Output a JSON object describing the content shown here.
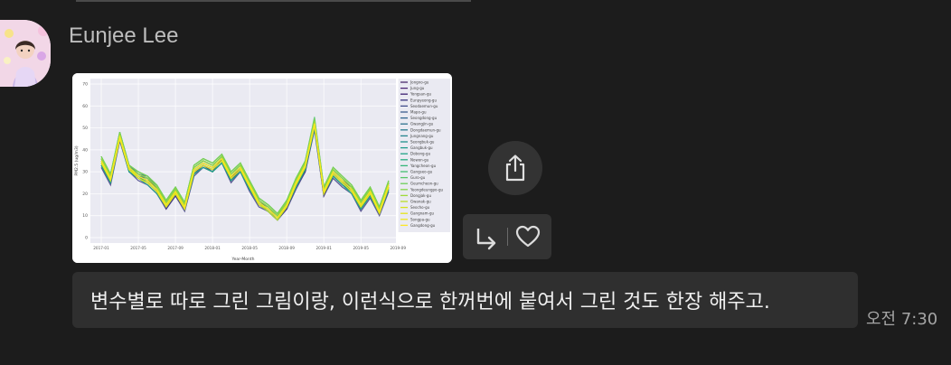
{
  "message": {
    "sender_name": "Eunjee Lee",
    "text": "변수별로 따로 그린 그림이랑, 이런식으로 한꺼번에 붙여서 그린 것도 한장 해주고.",
    "timestamp": "오전 7:30"
  },
  "icons": {
    "share": "share-icon",
    "reply": "reply-icon",
    "like": "heart-icon",
    "avatar": "avatar"
  },
  "colors": {
    "background": "#1c1c1c",
    "bubble": "#2f2f2f",
    "button": "#333333"
  },
  "chart_data": {
    "type": "line",
    "xlabel": "Year-Month",
    "ylabel": "PM2.5 (ug/m3)",
    "ylim": [
      0,
      70
    ],
    "y_ticks": [
      "0",
      "10",
      "20",
      "30",
      "40",
      "50",
      "60",
      "70"
    ],
    "x_ticks": [
      "2017-01",
      "2017-05",
      "2017-09",
      "2018-01",
      "2018-05",
      "2018-09",
      "2019-01",
      "2019-05",
      "2019-09"
    ],
    "grid": true,
    "legend_position": "right",
    "series": [
      {
        "name": "Jongno-gu",
        "color": "#46246a",
        "values": [
          34,
          26,
          46,
          31,
          28,
          26,
          22,
          14,
          20,
          14,
          30,
          33,
          30,
          36,
          27,
          32,
          23,
          16,
          13,
          9,
          14,
          24,
          31,
          51,
          20,
          29,
          25,
          22,
          14,
          20,
          12,
          23
        ]
      },
      {
        "name": "Jung-gu",
        "color": "#482173",
        "values": [
          33,
          25,
          45,
          30,
          27,
          25,
          21,
          13,
          19,
          13,
          29,
          33,
          31,
          35,
          26,
          31,
          22,
          15,
          12,
          8,
          13,
          23,
          30,
          50,
          19,
          28,
          24,
          21,
          13,
          19,
          11,
          22
        ]
      },
      {
        "name": "Yongsan-gu",
        "color": "#472c7a",
        "values": [
          35,
          27,
          47,
          32,
          29,
          27,
          22,
          15,
          21,
          14,
          31,
          34,
          32,
          36,
          28,
          32,
          24,
          16,
          13,
          9,
          15,
          25,
          33,
          52,
          21,
          30,
          26,
          23,
          15,
          21,
          13,
          24
        ]
      },
      {
        "name": "Eunpyeong-gu",
        "color": "#433e85",
        "values": [
          32,
          24,
          44,
          30,
          26,
          24,
          20,
          13,
          19,
          12,
          28,
          32,
          30,
          34,
          25,
          30,
          21,
          14,
          12,
          8,
          13,
          22,
          30,
          49,
          19,
          27,
          23,
          20,
          12,
          18,
          10,
          21
        ]
      },
      {
        "name": "Seodaemun-gu",
        "color": "#3e4c8a",
        "values": [
          34,
          26,
          46,
          31,
          28,
          26,
          22,
          14,
          20,
          14,
          30,
          33,
          31,
          35,
          27,
          31,
          23,
          16,
          13,
          9,
          14,
          24,
          32,
          51,
          20,
          29,
          25,
          22,
          14,
          20,
          12,
          23
        ]
      },
      {
        "name": "Mapo-gu",
        "color": "#38598c",
        "values": [
          35,
          27,
          47,
          32,
          28,
          27,
          22,
          15,
          21,
          14,
          31,
          34,
          32,
          36,
          28,
          32,
          24,
          16,
          14,
          10,
          15,
          25,
          33,
          52,
          21,
          30,
          26,
          22,
          15,
          21,
          12,
          24
        ]
      },
      {
        "name": "Seongdong-gu",
        "color": "#32658e",
        "values": [
          36,
          28,
          48,
          33,
          29,
          28,
          23,
          16,
          22,
          15,
          32,
          35,
          33,
          37,
          29,
          33,
          25,
          17,
          14,
          10,
          16,
          26,
          34,
          53,
          22,
          31,
          27,
          23,
          16,
          22,
          13,
          25
        ]
      },
      {
        "name": "Gwangjin-gu",
        "color": "#2d718e",
        "values": [
          35,
          27,
          46,
          31,
          28,
          26,
          22,
          15,
          21,
          14,
          31,
          34,
          32,
          36,
          28,
          32,
          24,
          16,
          13,
          9,
          15,
          25,
          33,
          52,
          21,
          30,
          26,
          22,
          15,
          21,
          12,
          24
        ]
      },
      {
        "name": "Dongdaemun-gu",
        "color": "#297b8e",
        "values": [
          36,
          28,
          47,
          32,
          29,
          27,
          23,
          16,
          22,
          15,
          32,
          35,
          33,
          37,
          29,
          33,
          25,
          17,
          14,
          10,
          16,
          26,
          34,
          53,
          22,
          31,
          27,
          23,
          16,
          22,
          13,
          25
        ]
      },
      {
        "name": "Jungnang-gu",
        "color": "#25858e",
        "values": [
          34,
          26,
          46,
          31,
          28,
          25,
          21,
          14,
          20,
          13,
          30,
          33,
          31,
          35,
          27,
          31,
          23,
          15,
          13,
          9,
          14,
          24,
          32,
          51,
          20,
          29,
          25,
          21,
          14,
          20,
          11,
          23
        ]
      },
      {
        "name": "Seongbuk-gu",
        "color": "#21918c",
        "values": [
          33,
          25,
          45,
          30,
          27,
          25,
          21,
          14,
          20,
          13,
          29,
          32,
          30,
          34,
          26,
          30,
          22,
          15,
          12,
          8,
          14,
          23,
          31,
          50,
          20,
          28,
          24,
          21,
          13,
          19,
          11,
          22
        ]
      },
      {
        "name": "Gangbuk-gu",
        "color": "#1e9b8a",
        "values": [
          34,
          26,
          46,
          31,
          28,
          26,
          22,
          15,
          21,
          14,
          30,
          33,
          31,
          35,
          27,
          31,
          23,
          16,
          13,
          9,
          15,
          24,
          32,
          51,
          21,
          29,
          25,
          22,
          14,
          20,
          12,
          23
        ]
      },
      {
        "name": "Dobong-gu",
        "color": "#20a486",
        "values": [
          33,
          25,
          45,
          30,
          27,
          24,
          20,
          14,
          20,
          13,
          29,
          32,
          30,
          34,
          26,
          30,
          22,
          15,
          12,
          8,
          14,
          23,
          31,
          50,
          20,
          28,
          24,
          20,
          13,
          19,
          11,
          22
        ]
      },
      {
        "name": "Nowon-gu",
        "color": "#28ae80",
        "values": [
          34,
          26,
          46,
          31,
          28,
          25,
          21,
          14,
          20,
          13,
          30,
          33,
          31,
          35,
          27,
          31,
          23,
          15,
          13,
          9,
          14,
          24,
          32,
          51,
          20,
          29,
          25,
          21,
          14,
          20,
          11,
          23
        ]
      },
      {
        "name": "Yangcheon-gu",
        "color": "#35b779",
        "values": [
          37,
          29,
          48,
          33,
          30,
          28,
          24,
          17,
          23,
          16,
          33,
          36,
          34,
          38,
          30,
          34,
          26,
          18,
          15,
          11,
          17,
          27,
          35,
          54,
          23,
          32,
          28,
          24,
          17,
          23,
          14,
          26
        ]
      },
      {
        "name": "Gangseo-gu",
        "color": "#44bf70",
        "values": [
          36,
          28,
          47,
          32,
          29,
          27,
          23,
          16,
          22,
          15,
          32,
          35,
          33,
          37,
          29,
          33,
          25,
          17,
          14,
          10,
          16,
          26,
          34,
          53,
          22,
          31,
          27,
          23,
          16,
          22,
          13,
          25
        ]
      },
      {
        "name": "Guro-gu",
        "color": "#56c667",
        "values": [
          37,
          29,
          48,
          33,
          30,
          28,
          24,
          17,
          23,
          16,
          33,
          36,
          34,
          38,
          30,
          34,
          26,
          18,
          15,
          11,
          17,
          27,
          35,
          55,
          23,
          32,
          28,
          24,
          17,
          23,
          14,
          26
        ]
      },
      {
        "name": "Geumcheon-gu",
        "color": "#6ccd5a",
        "values": [
          36,
          28,
          47,
          32,
          29,
          27,
          23,
          16,
          22,
          15,
          32,
          35,
          33,
          37,
          29,
          33,
          25,
          17,
          14,
          10,
          16,
          26,
          34,
          53,
          22,
          31,
          27,
          23,
          16,
          22,
          13,
          25
        ]
      },
      {
        "name": "Yeongdeungpo-gu",
        "color": "#84d44b",
        "values": [
          37,
          29,
          48,
          33,
          30,
          28,
          24,
          17,
          23,
          16,
          33,
          36,
          34,
          38,
          30,
          34,
          26,
          18,
          15,
          11,
          17,
          27,
          35,
          54,
          23,
          32,
          28,
          24,
          17,
          23,
          14,
          26
        ]
      },
      {
        "name": "Dongjak-gu",
        "color": "#9fda3a",
        "values": [
          36,
          28,
          47,
          32,
          29,
          27,
          23,
          16,
          22,
          15,
          32,
          35,
          33,
          37,
          29,
          33,
          25,
          17,
          14,
          10,
          16,
          26,
          34,
          53,
          22,
          31,
          27,
          23,
          16,
          22,
          13,
          25
        ]
      },
      {
        "name": "Gwanak-gu",
        "color": "#bade28",
        "values": [
          35,
          27,
          46,
          32,
          28,
          26,
          22,
          15,
          21,
          14,
          31,
          34,
          32,
          36,
          28,
          32,
          24,
          16,
          13,
          9,
          15,
          25,
          33,
          52,
          21,
          30,
          26,
          22,
          15,
          21,
          12,
          24
        ]
      },
      {
        "name": "Seocho-gu",
        "color": "#d5e21a",
        "values": [
          34,
          26,
          45,
          31,
          27,
          25,
          21,
          14,
          20,
          13,
          30,
          33,
          31,
          35,
          27,
          31,
          23,
          15,
          12,
          8,
          14,
          24,
          32,
          51,
          20,
          29,
          25,
          21,
          14,
          20,
          11,
          23
        ]
      },
      {
        "name": "Gangnam-gu",
        "color": "#e4e41a",
        "values": [
          35,
          27,
          46,
          31,
          28,
          26,
          22,
          15,
          21,
          14,
          31,
          34,
          32,
          36,
          28,
          32,
          24,
          16,
          13,
          9,
          15,
          25,
          33,
          52,
          21,
          30,
          26,
          22,
          15,
          21,
          12,
          24
        ]
      },
      {
        "name": "Songpa-gu",
        "color": "#eee51c",
        "values": [
          34,
          26,
          45,
          31,
          27,
          25,
          21,
          14,
          20,
          13,
          30,
          33,
          31,
          35,
          27,
          31,
          23,
          15,
          13,
          9,
          14,
          24,
          32,
          51,
          20,
          29,
          25,
          21,
          14,
          20,
          11,
          23
        ]
      },
      {
        "name": "Gangdong-gu",
        "color": "#fde725",
        "values": [
          35,
          27,
          46,
          32,
          28,
          26,
          22,
          15,
          21,
          14,
          31,
          34,
          32,
          36,
          28,
          32,
          24,
          16,
          13,
          9,
          15,
          25,
          33,
          52,
          21,
          30,
          26,
          22,
          15,
          21,
          12,
          24
        ]
      }
    ]
  }
}
